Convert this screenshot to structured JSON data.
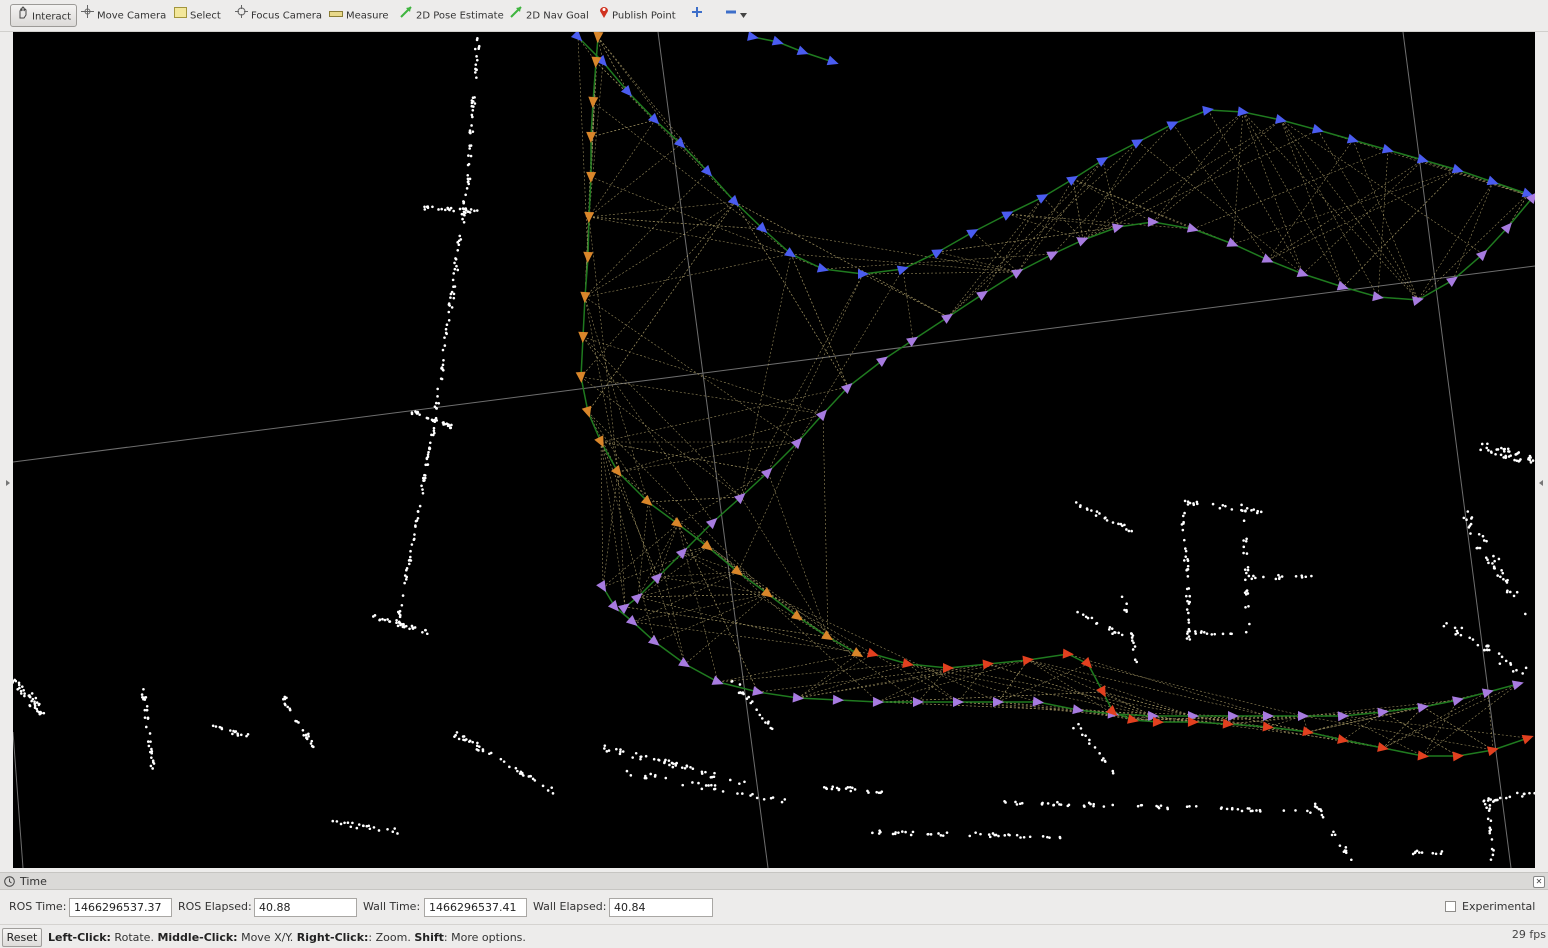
{
  "toolbar": {
    "tools": [
      {
        "label": "Interact",
        "icon": "hand-icon",
        "active": true
      },
      {
        "label": "Move Camera",
        "icon": "move-camera-icon"
      },
      {
        "label": "Select",
        "icon": "select-icon"
      },
      {
        "label": "Focus Camera",
        "icon": "focus-camera-icon"
      },
      {
        "label": "Measure",
        "icon": "ruler-icon"
      },
      {
        "label": "2D Pose Estimate",
        "icon": "green-arrow-icon"
      },
      {
        "label": "2D Nav Goal",
        "icon": "green-arrow-icon"
      },
      {
        "label": "Publish Point",
        "icon": "map-pin-icon"
      }
    ]
  },
  "time_panel": {
    "title": "Time",
    "ros_time_label": "ROS Time:",
    "ros_time": "1466296537.37",
    "ros_elapsed_label": "ROS Elapsed:",
    "ros_elapsed": "40.88",
    "wall_time_label": "Wall Time:",
    "wall_time": "1466296537.41",
    "wall_elapsed_label": "Wall Elapsed:",
    "wall_elapsed": "40.84",
    "experimental_label": "Experimental"
  },
  "status": {
    "reset_label": "Reset",
    "left_click": "Left-Click:",
    "left_click_action": " Rotate. ",
    "middle_click": "Middle-Click:",
    "middle_click_action": " Move X/Y. ",
    "right_click": "Right-Click:",
    "right_click_action": ": Zoom. ",
    "shift": "Shift",
    "shift_action": ": More options.",
    "fps": "29 fps"
  },
  "colors": {
    "background": "#000000",
    "point_cloud": "#ffffff",
    "edge_path": "#1f7a1f",
    "constraint_lines": "#c9b87a",
    "pose_blue": "#4a5cf0",
    "pose_purple": "#a77be0",
    "pose_orange": "#d9862a",
    "pose_red": "#e2401f"
  }
}
